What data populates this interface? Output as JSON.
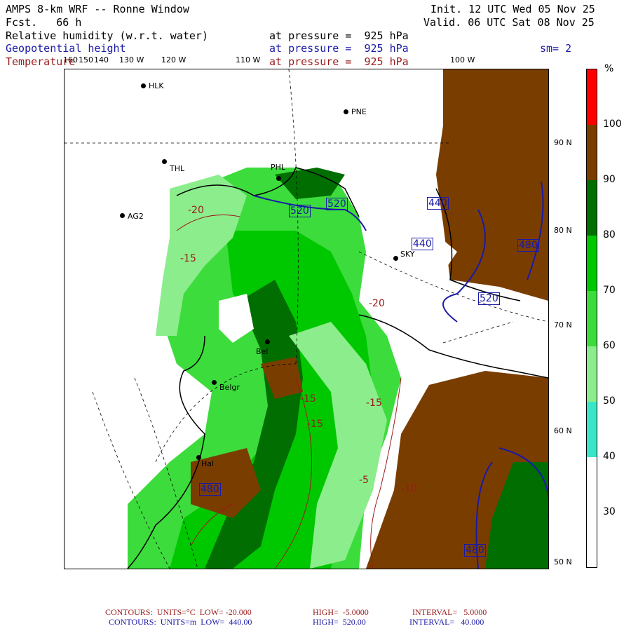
{
  "header": {
    "title": "AMPS 8-km WRF -- Ronne Window",
    "forecast": "Fcst.   66 h",
    "init": "Init. 12 UTC Wed 05 Nov 25",
    "valid": "Valid. 06 UTC Sat 08 Nov 25",
    "field1_name": "Relative humidity (w.r.t. water)",
    "field2_name": "Geopotential height",
    "field3_name": "Temperature",
    "level1": "at pressure =  925 hPa",
    "level2": "at pressure =  925 hPa",
    "level3": "at pressure =  925 hPa",
    "smoothing": "sm= 2"
  },
  "longitude_labels": [
    "160",
    "150",
    "140",
    "130 W",
    "120 W",
    "110 W",
    "100 W"
  ],
  "latitude_labels": [
    "90 N",
    "80 N",
    "70 N",
    "60 N",
    "50 N"
  ],
  "stations": [
    "HLK",
    "PNE",
    "THL",
    "PHL",
    "AG2",
    "SKY",
    "Bel",
    "Belgr",
    "Hal"
  ],
  "height_contour_labels": [
    "520",
    "520",
    "440",
    "440",
    "480",
    "520",
    "480",
    "480"
  ],
  "temperature_contour_labels": [
    "-20",
    "-15",
    "-20",
    "-15",
    "-15",
    "-15",
    "-5",
    "-10"
  ],
  "legend": {
    "unit": "%",
    "levels": [
      "100",
      "90",
      "80",
      "70",
      "60",
      "50",
      "40",
      "30"
    ],
    "colors": [
      "#ff0000",
      "#7a3d00",
      "#006e00",
      "#00c800",
      "#3cdc3c",
      "#8ced8c",
      "#39e6c8",
      "#ffffff"
    ]
  },
  "footer": {
    "line1_label": "CONTOURS:  UNITS=°C  LOW= -20.000",
    "line1_high": "HIGH=  -5.0000",
    "line1_interval": "INTERVAL=   5.0000",
    "line2_label": "CONTOURS:  UNITS=m  LOW=  440.00",
    "line2_high": "HIGH=  520.00",
    "line2_interval": "INTERVAL=   40.000"
  },
  "colors": {
    "brown": "#7a3d00",
    "dark_green": "#006e00",
    "green": "#00c800",
    "light_green": "#3cdc3c",
    "pale_green": "#8ced8c",
    "height_contour": "#1a1aa6",
    "temp_contour": "#9a1a1a"
  }
}
